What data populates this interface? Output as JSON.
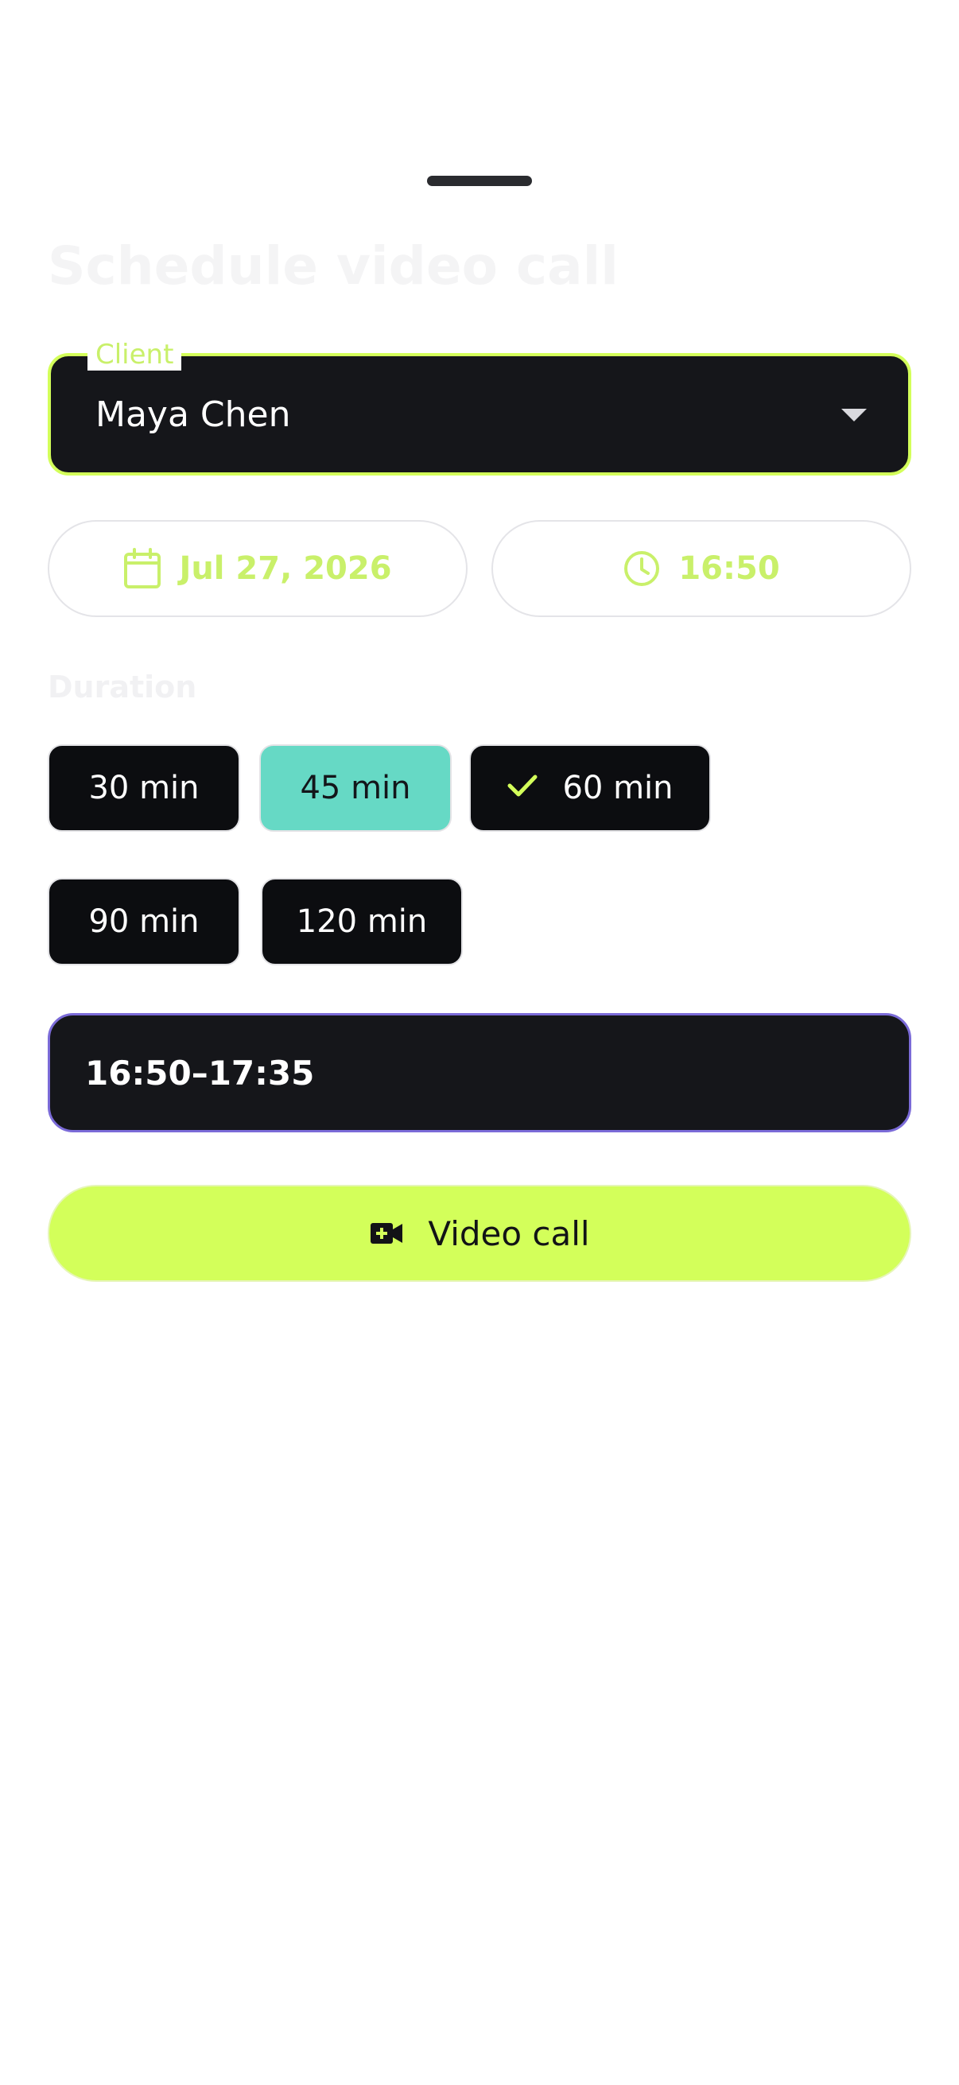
{
  "sheet": {
    "title": "Schedule video call"
  },
  "client": {
    "label": "Client",
    "value": "Maya Chen"
  },
  "date_pill": {
    "value": "Jul 27, 2026",
    "icon": "calendar-icon"
  },
  "time_pill": {
    "value": "16:50",
    "icon": "clock-icon"
  },
  "duration": {
    "label": "Duration",
    "options": [
      {
        "label": "30 min",
        "state": "default"
      },
      {
        "label": "45 min",
        "state": "highlighted"
      },
      {
        "label": "60 min",
        "state": "selected"
      },
      {
        "label": "90 min",
        "state": "default"
      },
      {
        "label": "120 min",
        "state": "default"
      }
    ]
  },
  "time_range": {
    "value": "16:50–17:35"
  },
  "cta": {
    "label": "Video call",
    "icon": "video-add-icon"
  },
  "colors": {
    "accent": "#d3ff5a",
    "teal": "#66d9c5",
    "dark_surface": "#15161a",
    "range_border": "#7b6bd8"
  }
}
